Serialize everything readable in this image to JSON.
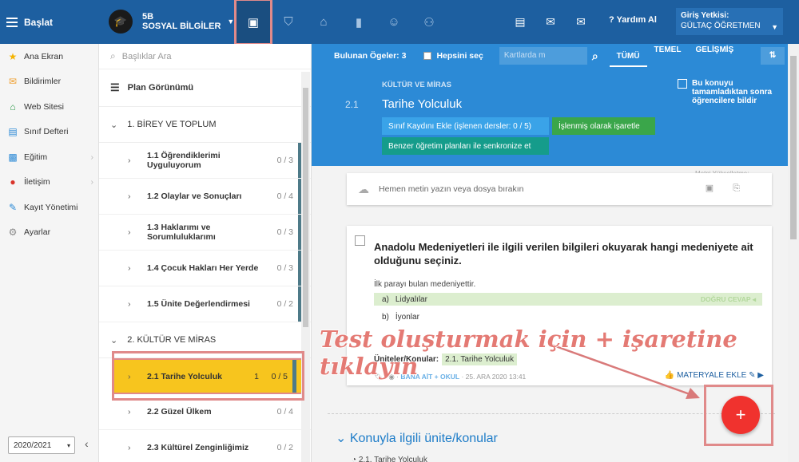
{
  "topbar": {
    "start_label": "Başlat",
    "class_badge": "5B",
    "class_name": "SOSYAL BİLGİLER",
    "help_label": "Yardım Al",
    "auth_title": "Giriş Yetkisi:",
    "auth_value": "GÜLTAÇ ÖĞRETMEN",
    "nav_icons": [
      "briefcase-icon",
      "shield-icon",
      "institution-icon",
      "bar-chart-icon",
      "smile-icon",
      "walking-icon"
    ],
    "right_icons": [
      "presentation-icon",
      "chat-icon",
      "mail-icon"
    ]
  },
  "sidebar": {
    "items": [
      {
        "label": "Ana Ekran",
        "icon": "star-icon"
      },
      {
        "label": "Bildirimler",
        "icon": "envelope-icon"
      },
      {
        "label": "Web Sitesi",
        "icon": "home-icon"
      },
      {
        "label": "Sınıf Defteri",
        "icon": "notebook-icon"
      },
      {
        "label": "Eğitim",
        "icon": "school-icon"
      },
      {
        "label": "İletişim",
        "icon": "comments-icon"
      },
      {
        "label": "Kayıt Yönetimi",
        "icon": "pen-icon"
      },
      {
        "label": "Ayarlar",
        "icon": "cog-icon"
      }
    ],
    "year": "2020/2021"
  },
  "middle": {
    "search_placeholder": "Başlıklar Ara",
    "plan_view": "Plan Görünümü",
    "units": [
      {
        "label": "1. BİREY VE TOPLUM"
      },
      {
        "label": "2. KÜLTÜR VE MİRAS"
      }
    ],
    "topics1": [
      {
        "label": "1.1 Öğrendiklerimi Uyguluyorum",
        "count": "0 / 3"
      },
      {
        "label": "1.2 Olaylar ve Sonuçları",
        "count": "0 / 4"
      },
      {
        "label": "1.3 Haklarımı ve Sorumluluklarımı",
        "count": "0 / 3"
      },
      {
        "label": "1.4 Çocuk Hakları Her Yerde",
        "count": "0 / 3"
      },
      {
        "label": "1.5 Ünite Değerlendirmesi",
        "count": "0 / 2"
      }
    ],
    "topics2": [
      {
        "label": "2.1 Tarihe Yolculuk",
        "num": "1",
        "count": "0 / 5"
      },
      {
        "label": "2.2 Güzel Ülkem",
        "count": "0 / 4"
      },
      {
        "label": "2.3 Kültürel Zenginliğimiz",
        "count": "0 / 2"
      }
    ]
  },
  "main": {
    "found": "Bulunan Ögeler: 3",
    "select_all": "Hepsini seç",
    "cards_placeholder": "Kartlarda m",
    "tabs": [
      "TÜMÜ",
      "TEMEL",
      "GELİŞMİŞ"
    ],
    "category": "KÜLTÜR VE MİRAS",
    "topic_num": "2.1",
    "topic_title": "Tarihe Yolculuk",
    "done_text": "Bu konuyu tamamladıktan sonra öğrencilere bildir",
    "btn_register": "Sınıf Kaydını Ekle (işlenen dersler: 0 / 5)",
    "btn_mark": "İşlenmiş olarak işaretle",
    "btn_sync": "Benzer öğretim planları ile senkronize et",
    "upload_text": "Hemen metin yazın veya dosya bırakın",
    "meta_label": "Metni Yükselletme:",
    "question": {
      "text": "Anadolu Medeniyetleri ile ilgili verilen bilgileri okuyarak hangi medeniyete ait olduğunu seçiniz.",
      "statement": "İlk parayı bulan medeniyettir.",
      "options": [
        {
          "letter": "a)",
          "text": "Lidyalılar",
          "correct": "DOĞRU CEVAP"
        },
        {
          "letter": "b)",
          "text": "İyonlar"
        }
      ],
      "topics_label": "Üniteler/Konular:",
      "topic_chip": "2.1. Tarihe Yolculuk",
      "owner": "BANA AİT + OKUL",
      "date": "25. ARA 2020 13:41",
      "add_material": "MATERYALE EKLE"
    },
    "related_title": "Konuyla ilgili ünite/konular",
    "related_item": "2.1. Tarihe Yolculuk",
    "overlay_text": "Test oluşturmak için + işaretine tıklayın",
    "fab_label": "+"
  }
}
